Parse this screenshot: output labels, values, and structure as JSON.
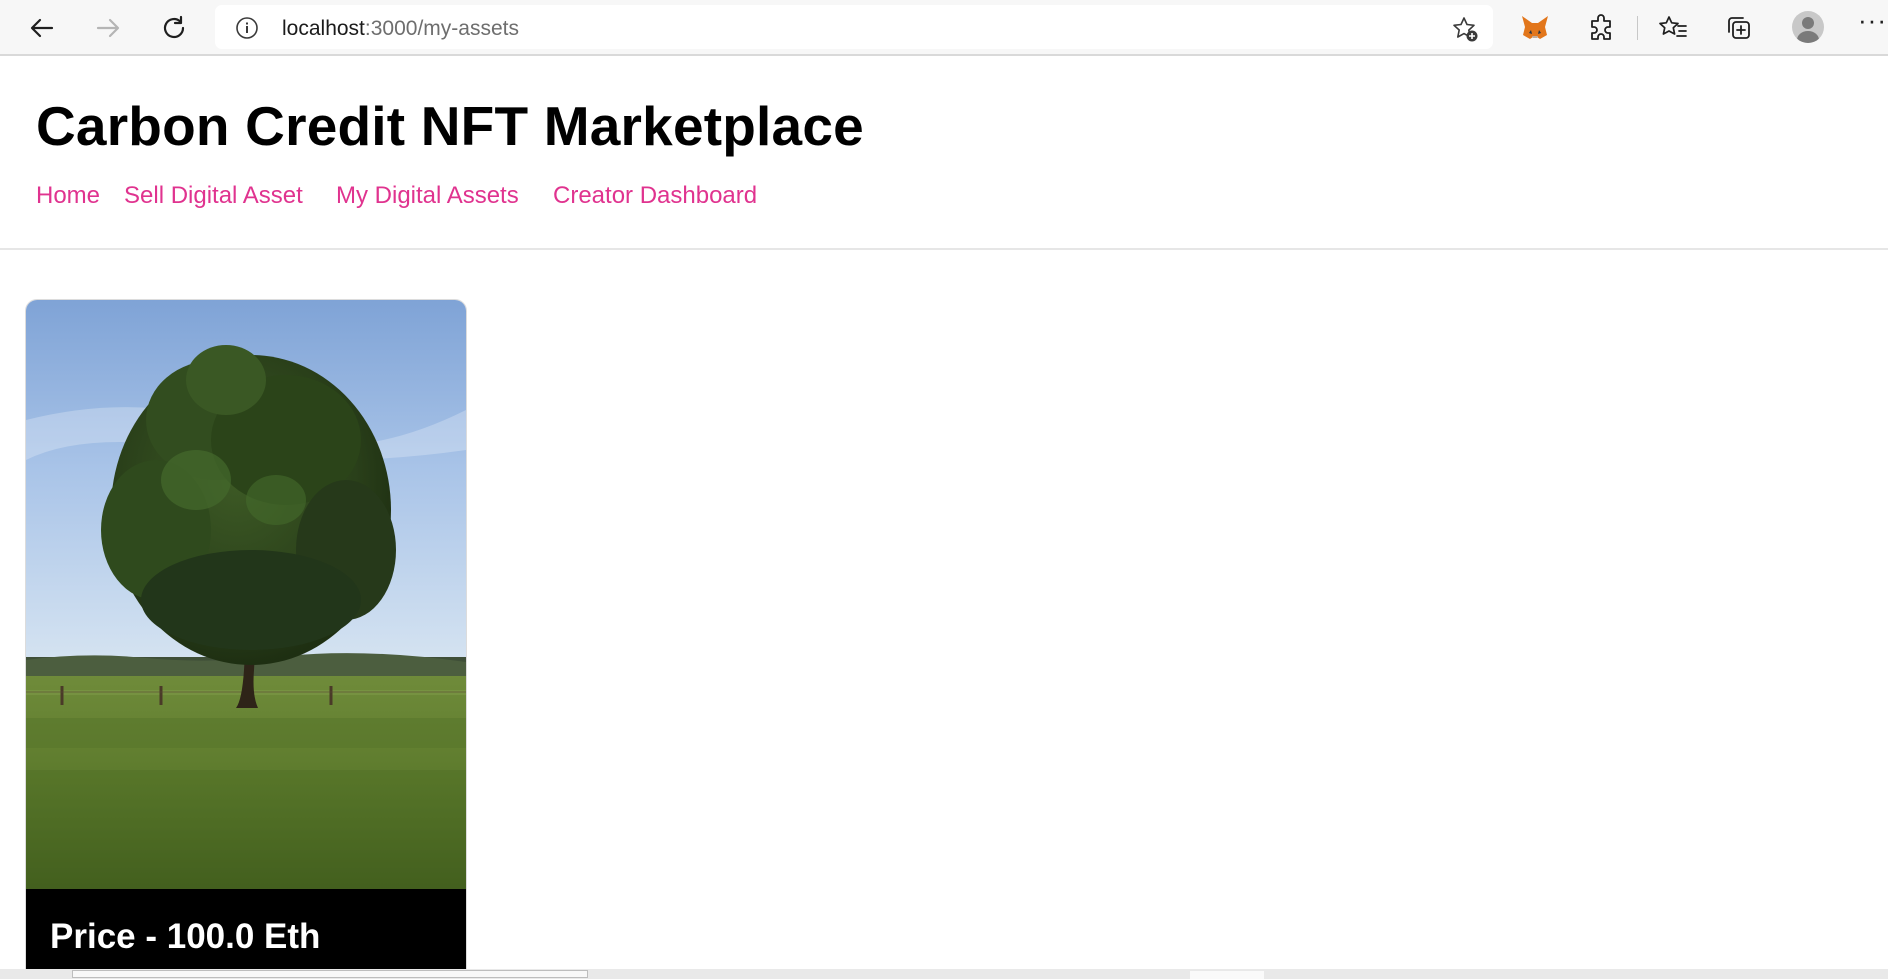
{
  "browser": {
    "url_host": "localhost",
    "url_path": ":3000/my-assets",
    "icons": {
      "back": "back-arrow-icon",
      "forward": "forward-arrow-icon",
      "reload": "reload-icon",
      "site_info": "info-icon",
      "add_favorite": "star-plus-icon",
      "metamask": "fox-icon",
      "extensions": "puzzle-icon",
      "favorites": "star-list-icon",
      "collections": "collections-icon",
      "profile": "avatar-icon",
      "more": "ellipsis-icon"
    },
    "more_label": "···"
  },
  "site": {
    "title": "Carbon Credit NFT Marketplace",
    "nav": [
      {
        "label": "Home"
      },
      {
        "label": "Sell Digital Asset"
      },
      {
        "label": "My Digital Assets"
      },
      {
        "label": "Creator Dashboard"
      }
    ],
    "accent_color": "#e0338f"
  },
  "assets": [
    {
      "image": "tree-in-field-photo",
      "price_label": "Price - 100.0 Eth"
    }
  ]
}
